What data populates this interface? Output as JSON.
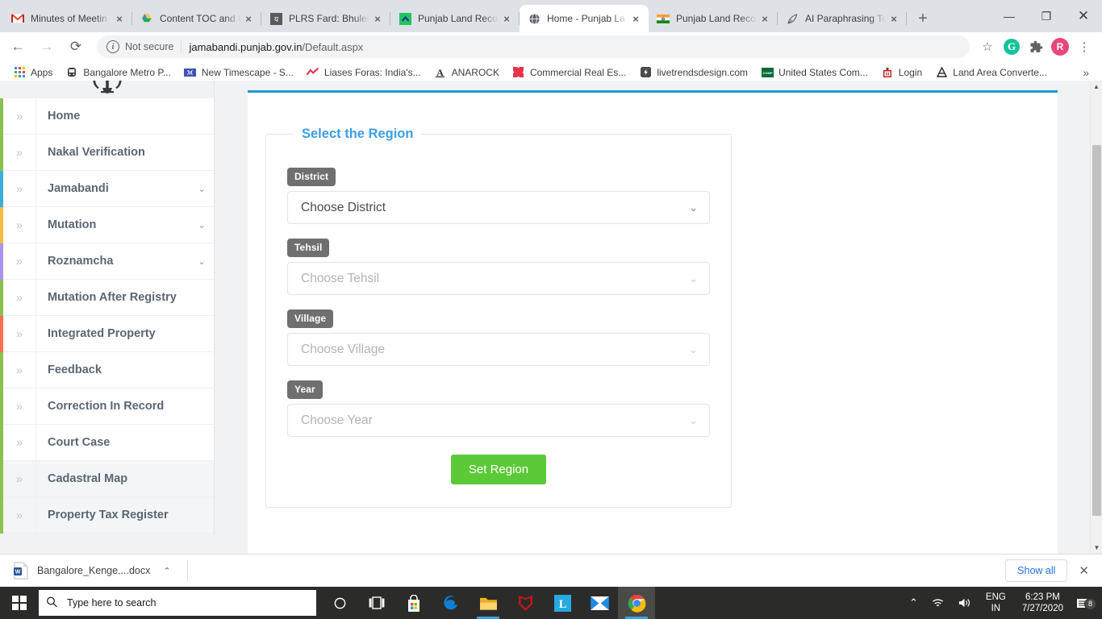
{
  "browser": {
    "tabs": [
      {
        "title": "Minutes of Meetin",
        "favicon": "gmail-icon",
        "active": false
      },
      {
        "title": "Content TOC and F",
        "favicon": "google-drive-icon",
        "active": false
      },
      {
        "title": "PLRS Fard: Bhulekh",
        "favicon": "plrs-icon",
        "active": false
      },
      {
        "title": "Punjab Land Reco",
        "favicon": "green-chevron-icon",
        "active": false
      },
      {
        "title": "Home - Punjab La",
        "favicon": "globe-icon",
        "active": true
      },
      {
        "title": "Punjab Land Recor",
        "favicon": "india-flag-icon",
        "active": false
      },
      {
        "title": "AI Paraphrasing To",
        "favicon": "quill-icon",
        "active": false
      }
    ],
    "new_tab_label": "+",
    "tab_close_label": "×",
    "window_controls": {
      "minimize": "—",
      "maximize": "❐",
      "close": "✕"
    },
    "toolbar": {
      "back": "←",
      "forward": "→",
      "reload": "⟳",
      "security_label": "Not secure",
      "url": "jamabandi.punjab.gov.in",
      "url_path": "/Default.aspx",
      "bookmark_star": "☆",
      "grammarly": "G",
      "extensions": "🧩",
      "profile_initial": "R",
      "menu": "⋮"
    },
    "bookmarks": [
      {
        "label": "Apps",
        "icon": "apps-grid-icon"
      },
      {
        "label": "Bangalore Metro P...",
        "icon": "metro-icon"
      },
      {
        "label": "New Timescape - S...",
        "icon": "timescape-icon"
      },
      {
        "label": "Liases Foras: India's...",
        "icon": "liases-icon"
      },
      {
        "label": "ANAROCK",
        "icon": "anarock-icon"
      },
      {
        "label": "Commercial Real Es...",
        "icon": "commercial-icon"
      },
      {
        "label": "livetrendsdesign.com",
        "icon": "livetrends-icon"
      },
      {
        "label": "United States Com...",
        "icon": "usa-icon"
      },
      {
        "label": "Login",
        "icon": "login-icon"
      },
      {
        "label": "Land Area Converte...",
        "icon": "landarea-icon"
      }
    ],
    "bookmarks_overflow": "»"
  },
  "sidebar": {
    "emblem": "india-national-emblem",
    "chevron_right": "»",
    "chevron_down": "⌄",
    "items": [
      {
        "label": "Home",
        "color": "#8cc152",
        "expandable": false,
        "alt": false
      },
      {
        "label": "Nakal Verification",
        "color": "#8cc152",
        "expandable": false,
        "alt": false
      },
      {
        "label": "Jamabandi",
        "color": "#3bafda",
        "expandable": true,
        "alt": false
      },
      {
        "label": "Mutation",
        "color": "#f6bb42",
        "expandable": true,
        "alt": false
      },
      {
        "label": "Roznamcha",
        "color": "#ac92ec",
        "expandable": true,
        "alt": false
      },
      {
        "label": "Mutation After Registry",
        "color": "#8cc152",
        "expandable": false,
        "alt": false
      },
      {
        "label": "Integrated Property",
        "color": "#fc6e51",
        "expandable": false,
        "alt": false
      },
      {
        "label": "Feedback",
        "color": "#8cc152",
        "expandable": false,
        "alt": false
      },
      {
        "label": "Correction In Record",
        "color": "#8cc152",
        "expandable": false,
        "alt": false
      },
      {
        "label": "Court Case",
        "color": "#8cc152",
        "expandable": false,
        "alt": false
      },
      {
        "label": "Cadastral Map",
        "color": "#8cc152",
        "expandable": false,
        "alt": true
      },
      {
        "label": "Property Tax Register",
        "color": "#8cc152",
        "expandable": false,
        "alt": true
      }
    ]
  },
  "main": {
    "legend": "Select the Region",
    "accent_color": "#2196d3",
    "fields": [
      {
        "tag": "District",
        "value": "Choose District",
        "state": "strong"
      },
      {
        "tag": "Tehsil",
        "value": "Choose Tehsil",
        "state": "muted"
      },
      {
        "tag": "Village",
        "value": "Choose Village",
        "state": "muted"
      },
      {
        "tag": "Year",
        "value": "Choose Year",
        "state": "muted"
      }
    ],
    "caret": "⌄",
    "submit_label": "Set Region",
    "submit_color": "#5cc939"
  },
  "scrollbar": {
    "up": "▲",
    "down": "▼"
  },
  "download_shelf": {
    "file_name": "Bangalore_Kenge....docx",
    "file_icon": "word-doc-icon",
    "caret": "⌃",
    "show_all_label": "Show all",
    "close_label": "✕"
  },
  "taskbar": {
    "start_icon": "windows-logo-icon",
    "search_placeholder": "Type here to search",
    "search_icon": "search-icon",
    "icons": [
      {
        "name": "cortana-icon",
        "glyph": "○",
        "running": false,
        "focused": false
      },
      {
        "name": "task-view-icon",
        "glyph": "⧉",
        "running": false,
        "focused": false
      },
      {
        "name": "microsoft-store-icon",
        "glyph": "",
        "running": false,
        "focused": false
      },
      {
        "name": "edge-icon",
        "glyph": "e",
        "running": false,
        "focused": false
      },
      {
        "name": "file-explorer-icon",
        "glyph": "",
        "running": true,
        "focused": false
      },
      {
        "name": "mcafee-icon",
        "glyph": "",
        "running": false,
        "focused": false
      },
      {
        "name": "lumion-icon",
        "glyph": "L",
        "running": false,
        "focused": false
      },
      {
        "name": "mail-icon",
        "glyph": "",
        "running": false,
        "focused": false
      },
      {
        "name": "chrome-icon",
        "glyph": "",
        "running": true,
        "focused": true
      }
    ],
    "tray": {
      "overflow": "⌃",
      "wifi": "wifi-icon",
      "volume": "volume-icon",
      "lang_line1": "ENG",
      "lang_line2": "IN",
      "time": "6:23 PM",
      "date": "7/27/2020",
      "notification_icon": "notifications-icon",
      "notification_count": "8"
    }
  }
}
